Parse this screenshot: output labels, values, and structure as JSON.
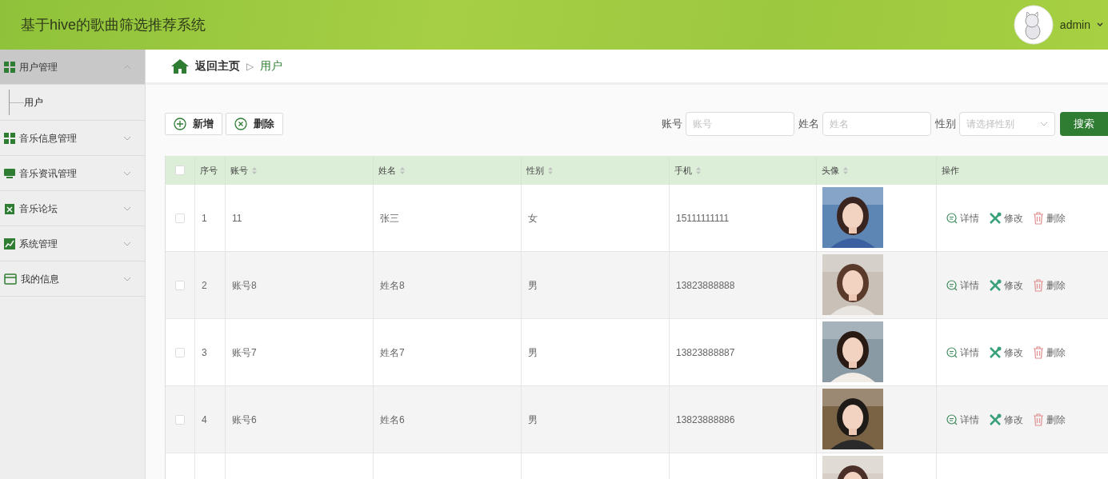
{
  "header": {
    "title": "基于hive的歌曲筛选推荐系统",
    "user": "admin"
  },
  "sidebar": {
    "items": [
      {
        "label": "用户管理",
        "kind": "grid",
        "expanded": true,
        "children": [
          {
            "label": "用户"
          }
        ]
      },
      {
        "label": "音乐信息管理",
        "kind": "grid",
        "expanded": false
      },
      {
        "label": "音乐资讯管理",
        "kind": "monitor",
        "expanded": false
      },
      {
        "label": "音乐论坛",
        "kind": "clipboard",
        "expanded": false
      },
      {
        "label": "系统管理",
        "kind": "chart",
        "expanded": false
      },
      {
        "label": "我的信息",
        "kind": "card",
        "expanded": false
      }
    ]
  },
  "breadcrumb": {
    "home": "返回主页",
    "separator": "▷",
    "current": "用户"
  },
  "toolbar": {
    "buttons": [
      {
        "kind": "add",
        "label": "新增"
      },
      {
        "kind": "delete",
        "label": "删除"
      }
    ],
    "filters": [
      {
        "kind": "input",
        "label": "账号",
        "placeholder": "账号"
      },
      {
        "kind": "input",
        "label": "姓名",
        "placeholder": "姓名"
      },
      {
        "kind": "select",
        "label": "性别",
        "placeholder": "请选择性别"
      }
    ],
    "search": "搜索"
  },
  "table": {
    "select_all": {
      "checked": false
    },
    "columns": [
      {
        "label": "序号",
        "sortable": false
      },
      {
        "label": "账号",
        "sortable": true
      },
      {
        "label": "姓名",
        "sortable": true
      },
      {
        "label": "性别",
        "sortable": true
      },
      {
        "label": "手机",
        "sortable": true
      },
      {
        "label": "头像",
        "sortable": true
      },
      {
        "label": "操作",
        "sortable": false
      }
    ],
    "rows": [
      {
        "checked": false,
        "no": "1",
        "account": "11",
        "name": "张三",
        "gender": "女",
        "phone": "15111111111",
        "avatar": {
          "kind": "picture"
        },
        "actions": [
          {
            "kind": "detail",
            "label": "详情"
          },
          {
            "kind": "edit",
            "label": "修改"
          },
          {
            "kind": "delete",
            "label": "删除"
          }
        ]
      },
      {
        "checked": false,
        "no": "2",
        "account": "账号8",
        "name": "姓名8",
        "gender": "男",
        "phone": "13823888888",
        "avatar": {
          "kind": "picture"
        },
        "actions": [
          {
            "kind": "detail",
            "label": "详情"
          },
          {
            "kind": "edit",
            "label": "修改"
          },
          {
            "kind": "delete",
            "label": "删除"
          }
        ]
      },
      {
        "checked": false,
        "no": "3",
        "account": "账号7",
        "name": "姓名7",
        "gender": "男",
        "phone": "13823888887",
        "avatar": {
          "kind": "picture"
        },
        "actions": [
          {
            "kind": "detail",
            "label": "详情"
          },
          {
            "kind": "edit",
            "label": "修改"
          },
          {
            "kind": "delete",
            "label": "删除"
          }
        ]
      },
      {
        "checked": false,
        "no": "4",
        "account": "账号6",
        "name": "姓名6",
        "gender": "男",
        "phone": "13823888886",
        "avatar": {
          "kind": "picture"
        },
        "actions": [
          {
            "kind": "detail",
            "label": "详情"
          },
          {
            "kind": "edit",
            "label": "修改"
          },
          {
            "kind": "delete",
            "label": "删除"
          }
        ]
      },
      {
        "avatar": {
          "kind": "picture"
        }
      }
    ]
  }
}
